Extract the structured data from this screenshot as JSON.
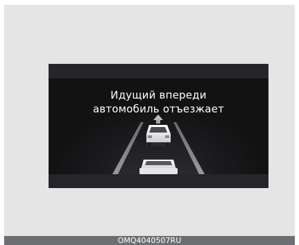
{
  "display": {
    "message_line1": "Идущий впереди",
    "message_line2": "автомобиль отъезжает"
  },
  "caption": {
    "code": "OMQ4040507RU"
  },
  "icons": {
    "lead_vehicle": "car-rear-icon",
    "own_vehicle": "car-rear-icon",
    "direction": "arrow-up-icon"
  }
}
